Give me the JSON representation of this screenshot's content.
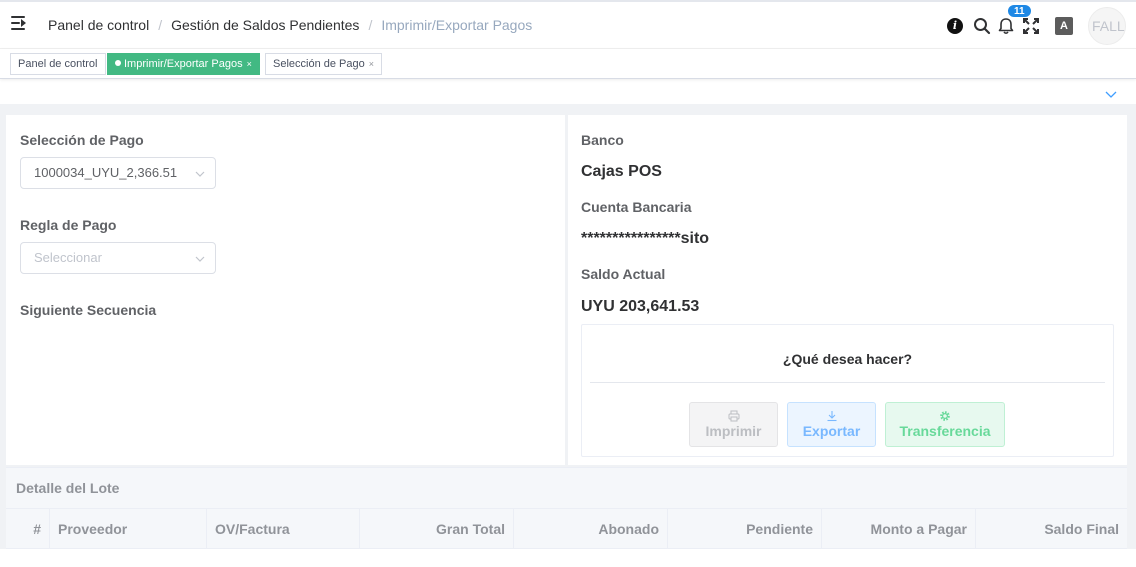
{
  "breadcrumb": [
    {
      "label": "Panel de control",
      "current": false
    },
    {
      "label": "Gestión de Saldos Pendientes",
      "current": false
    },
    {
      "label": "Imprimir/Exportar Pagos",
      "current": true
    }
  ],
  "breadcrumb_separator": "/",
  "header": {
    "notification_count": "11",
    "info_glyph": "i",
    "translate_glyph": "A",
    "avatar_text": "FALLA"
  },
  "tags": [
    {
      "label": "Panel de control",
      "active": false,
      "closable": false
    },
    {
      "label": "Imprimir/Exportar Pagos",
      "active": true,
      "closable": true
    },
    {
      "label": "Selección de Pago",
      "active": false,
      "closable": true
    }
  ],
  "tag_close": "×",
  "form": {
    "payment_selection_label": "Selección de Pago",
    "payment_selection_value": "1000034_UYU_2,366.51",
    "payment_rule_label": "Regla de Pago",
    "payment_rule_placeholder": "Seleccionar",
    "next_sequence_label": "Siguiente Secuencia"
  },
  "bank_info": {
    "bank_label": "Banco",
    "bank_value": "Cajas POS",
    "account_label": "Cuenta Bancaria",
    "account_value": "****************sito",
    "balance_label": "Saldo Actual",
    "balance_value": "UYU 203,641.53"
  },
  "actions": {
    "title": "¿Qué desea hacer?",
    "print_label": "Imprimir",
    "export_label": "Exportar",
    "transfer_label": "Transferencia"
  },
  "detail": {
    "title": "Detalle del Lote",
    "columns": [
      "#",
      "Proveedor",
      "OV/Factura",
      "Gran Total",
      "Abonado",
      "Pendiente",
      "Monto a Pagar",
      "Saldo Final"
    ]
  },
  "colors": {
    "active_tag": "#42b983",
    "badge": "#1e88e5",
    "export": "#79b8ff",
    "transfer": "#68d99a"
  }
}
